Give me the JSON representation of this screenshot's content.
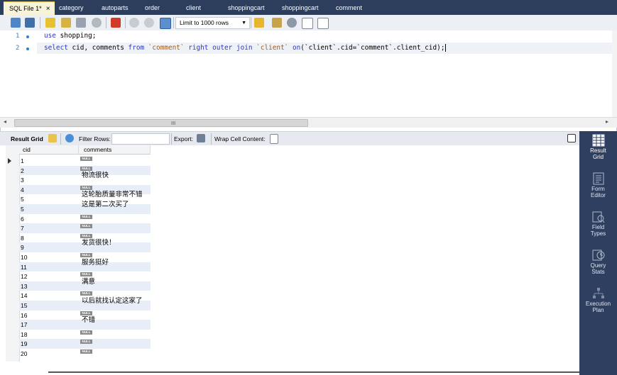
{
  "tabs": [
    {
      "label": "SQL File 1*",
      "active": true
    },
    {
      "label": "category"
    },
    {
      "label": "autoparts"
    },
    {
      "label": "order"
    },
    {
      "label": "client"
    },
    {
      "label": "shoppingcart"
    },
    {
      "label": "shoppingcart"
    },
    {
      "label": "comment"
    }
  ],
  "tab_close": "×",
  "toolbar": {
    "limit_label": "Limit to 1000 rows"
  },
  "editor": {
    "line_numbers": [
      "1",
      "2"
    ],
    "line1": {
      "kw": "use",
      "rest": " shopping;"
    },
    "line2": {
      "k1": "select",
      "t1": " cid, comments ",
      "k2": "from",
      "s1": " `comment` ",
      "k3": "right outer join",
      "s2": " `client` ",
      "k4": "on",
      "t2": "(`client`.cid=`comment`.client_cid);"
    },
    "hscroll_grip": "III"
  },
  "result_toolbar": {
    "result_grid": "Result Grid",
    "filter_rows": "Filter Rows:",
    "export": "Export:",
    "wrap_cell": "Wrap Cell Content:"
  },
  "grid": {
    "headers": [
      "cid",
      "comments"
    ],
    "null_label": "NULL",
    "rows": [
      {
        "cid": "1",
        "comment": null
      },
      {
        "cid": "2",
        "comment": null
      },
      {
        "cid": "3",
        "comment": "物流很快"
      },
      {
        "cid": "4",
        "comment": null
      },
      {
        "cid": "5",
        "comment": "这轮胎质量非常不错"
      },
      {
        "cid": "5",
        "comment": "这是第二次买了"
      },
      {
        "cid": "6",
        "comment": null
      },
      {
        "cid": "7",
        "comment": null
      },
      {
        "cid": "8",
        "comment": null
      },
      {
        "cid": "9",
        "comment": "发货很快！"
      },
      {
        "cid": "10",
        "comment": null
      },
      {
        "cid": "11",
        "comment": "服务挺好"
      },
      {
        "cid": "12",
        "comment": null
      },
      {
        "cid": "13",
        "comment": "满意"
      },
      {
        "cid": "14",
        "comment": null
      },
      {
        "cid": "15",
        "comment": "以后就找认定这家了"
      },
      {
        "cid": "16",
        "comment": null
      },
      {
        "cid": "17",
        "comment": "不错"
      },
      {
        "cid": "18",
        "comment": null
      },
      {
        "cid": "19",
        "comment": null
      },
      {
        "cid": "20",
        "comment": null
      }
    ]
  },
  "right_panel": [
    {
      "line1": "Result",
      "line2": "Grid",
      "icon": "result-grid-icon",
      "active": true
    },
    {
      "line1": "Form",
      "line2": "Editor",
      "icon": "form-editor-icon"
    },
    {
      "line1": "Field",
      "line2": "Types",
      "icon": "field-types-icon"
    },
    {
      "line1": "Query",
      "line2": "Stats",
      "icon": "query-stats-icon"
    },
    {
      "line1": "Execution",
      "line2": "Plan",
      "icon": "execution-plan-icon"
    }
  ],
  "colors": {
    "tabbar": "#2c3e5c",
    "active_tab": "#f7f3d9",
    "keyword": "#2d36c8",
    "string": "#a35a18",
    "side_panel": "#2f3f5f"
  }
}
